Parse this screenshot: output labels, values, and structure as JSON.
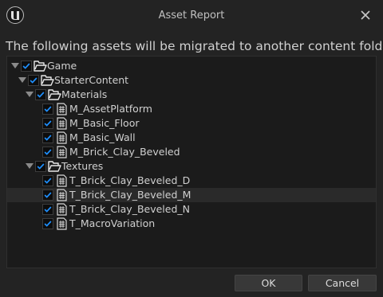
{
  "window": {
    "title": "Asset Report"
  },
  "header": "The following assets will be migrated to another content folder.",
  "tree": [
    {
      "label": "Game",
      "type": "folder",
      "depth": 0,
      "expanded": true,
      "checked": true
    },
    {
      "label": "StarterContent",
      "type": "folder",
      "depth": 1,
      "expanded": true,
      "checked": true
    },
    {
      "label": "Materials",
      "type": "folder",
      "depth": 2,
      "expanded": true,
      "checked": true
    },
    {
      "label": "M_AssetPlatform",
      "type": "file",
      "depth": 3,
      "checked": true
    },
    {
      "label": "M_Basic_Floor",
      "type": "file",
      "depth": 3,
      "checked": true
    },
    {
      "label": "M_Basic_Wall",
      "type": "file",
      "depth": 3,
      "checked": true
    },
    {
      "label": "M_Brick_Clay_Beveled",
      "type": "file",
      "depth": 3,
      "checked": true
    },
    {
      "label": "Textures",
      "type": "folder",
      "depth": 2,
      "expanded": true,
      "checked": true
    },
    {
      "label": "T_Brick_Clay_Beveled_D",
      "type": "file",
      "depth": 3,
      "checked": true
    },
    {
      "label": "T_Brick_Clay_Beveled_M",
      "type": "file",
      "depth": 3,
      "checked": true,
      "highlighted": true
    },
    {
      "label": "T_Brick_Clay_Beveled_N",
      "type": "file",
      "depth": 3,
      "checked": true
    },
    {
      "label": "T_MacroVariation",
      "type": "file",
      "depth": 3,
      "checked": true
    }
  ],
  "buttons": {
    "ok": "OK",
    "cancel": "Cancel"
  },
  "colors": {
    "check": "#1e90ff",
    "background": "#232323",
    "tree_bg": "#1b1b1b"
  },
  "icons": {
    "logo": "unreal-logo-icon",
    "close": "close-icon",
    "folder": "folder-icon",
    "file": "file-icon"
  }
}
